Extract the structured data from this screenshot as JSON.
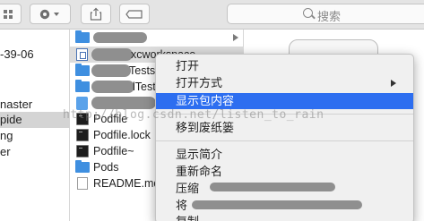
{
  "toolbar": {
    "search_placeholder": "搜索",
    "icons": [
      "grid-view-icon",
      "gear-icon",
      "share-icon",
      "tag-icon",
      "search-icon"
    ]
  },
  "sidebar_column": {
    "items": [
      {
        "label": "-39-06",
        "selected": false
      },
      {
        "label": "naster",
        "selected": false
      },
      {
        "label": "pide",
        "selected": true
      },
      {
        "label": "ng",
        "selected": false
      },
      {
        "label": "er",
        "selected": false
      }
    ]
  },
  "file_column": {
    "items": [
      {
        "label": "",
        "icon": "folder",
        "arrow": true,
        "selected": false
      },
      {
        "label": "xcworkspace",
        "icon": "xcode-workspace",
        "arrow": false,
        "selected": true
      },
      {
        "label": "Tests",
        "icon": "folder",
        "arrow": true,
        "selected": false
      },
      {
        "label": "lTest",
        "icon": "folder",
        "arrow": true,
        "selected": false
      },
      {
        "label": "",
        "icon": "xcode-project",
        "arrow": false,
        "selected": false
      },
      {
        "label": "Podfile",
        "icon": "terminal",
        "arrow": false,
        "selected": false
      },
      {
        "label": "Podfile.lock",
        "icon": "terminal",
        "arrow": false,
        "selected": false
      },
      {
        "label": "Podfile~",
        "icon": "terminal",
        "arrow": false,
        "selected": false
      },
      {
        "label": "Pods",
        "icon": "folder",
        "arrow": true,
        "selected": false
      },
      {
        "label": "README.md",
        "icon": "document",
        "arrow": false,
        "selected": false
      }
    ]
  },
  "context_menu": {
    "items": [
      {
        "label": "打开",
        "highlighted": false,
        "submenu": false
      },
      {
        "label": "打开方式",
        "highlighted": false,
        "submenu": true
      },
      {
        "label": "显示包内容",
        "highlighted": true,
        "submenu": false
      },
      {
        "label": "移到废纸篓",
        "highlighted": false,
        "submenu": false
      },
      {
        "label": "显示简介",
        "highlighted": false,
        "submenu": false
      },
      {
        "label": "重新命名",
        "highlighted": false,
        "submenu": false
      },
      {
        "label": "压缩",
        "highlighted": false,
        "submenu": false
      },
      {
        "label": "将",
        "highlighted": false,
        "submenu": false
      },
      {
        "label": "复制",
        "highlighted": false,
        "submenu": false
      }
    ]
  },
  "watermark": "http://blog.csdn.net/listen_to_rain",
  "colors": {
    "highlight": "#2d6ef0",
    "folder": "#3f8fe0"
  }
}
